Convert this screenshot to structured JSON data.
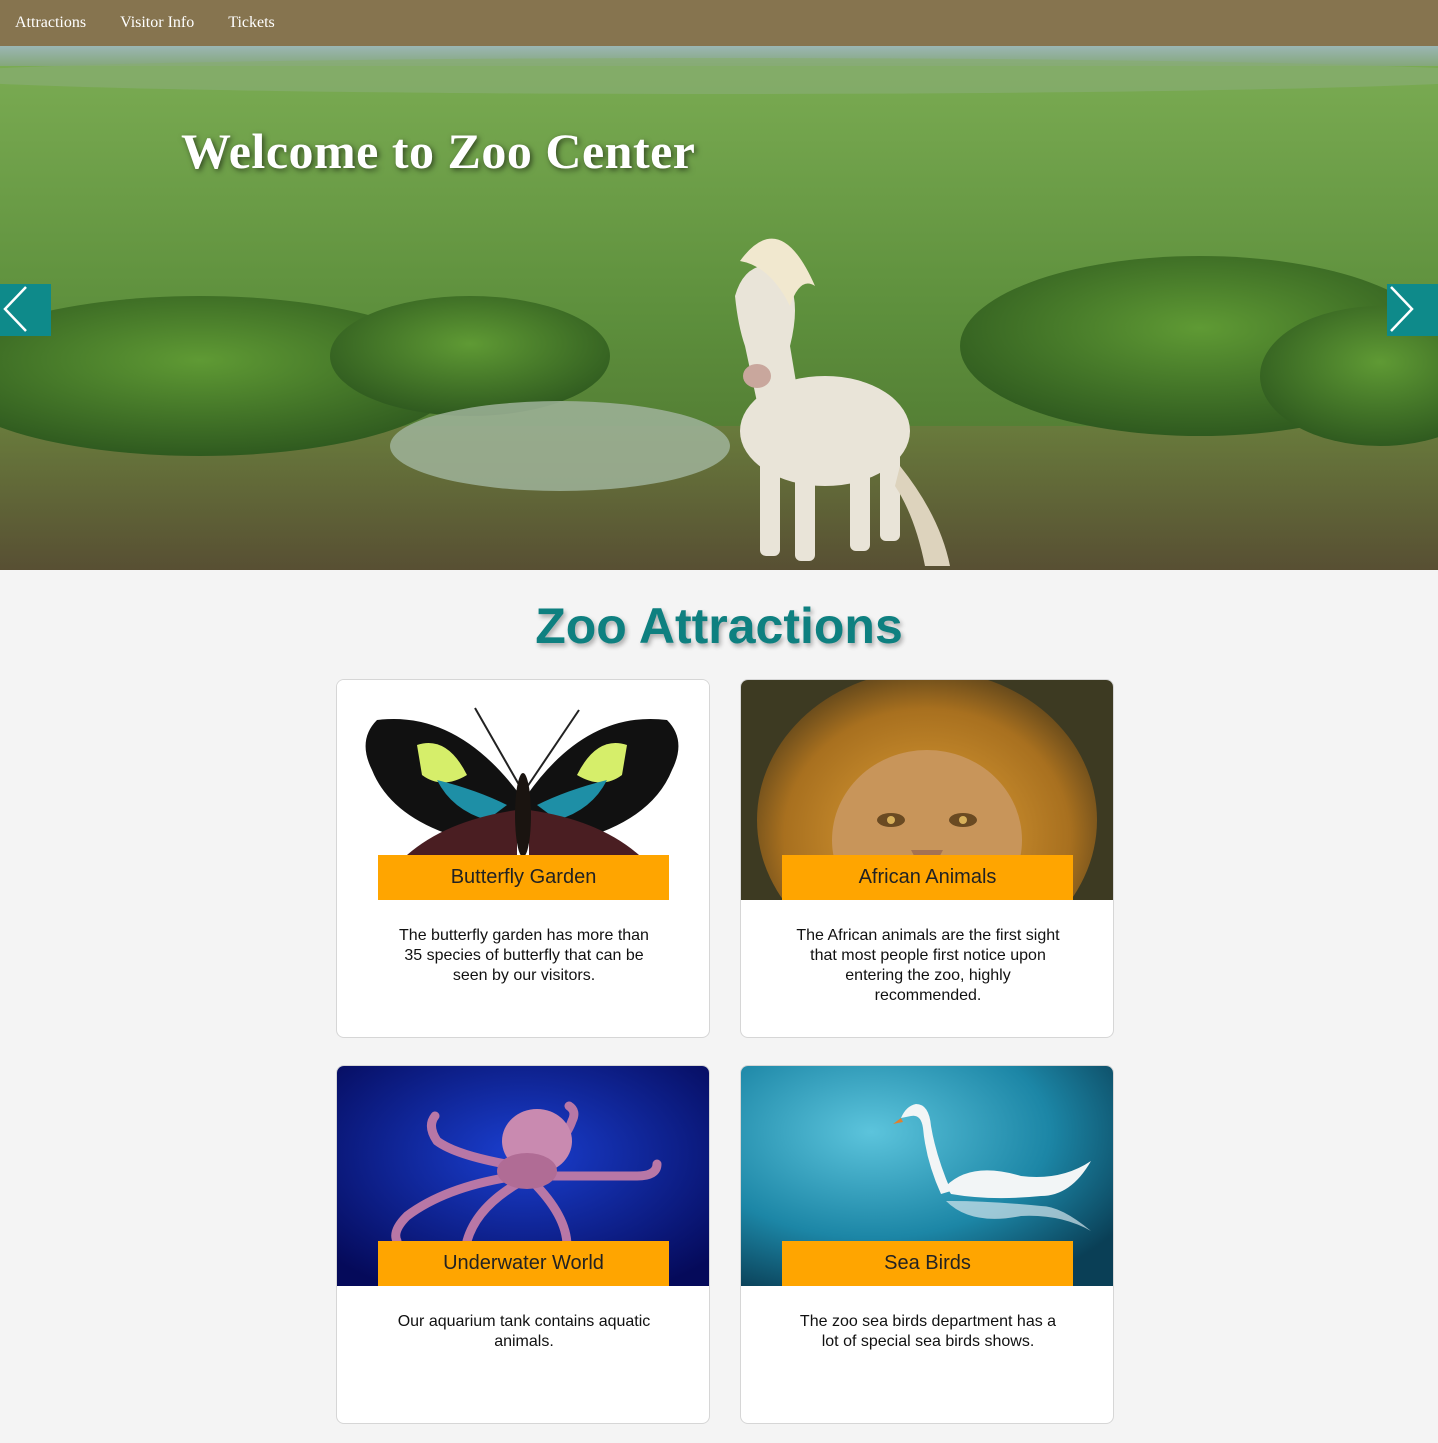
{
  "nav": {
    "items": [
      {
        "label": "Attractions"
      },
      {
        "label": "Visitor Info"
      },
      {
        "label": "Tickets"
      }
    ]
  },
  "hero": {
    "title": "Welcome to Zoo Center",
    "prev_icon": "chevron-left-icon",
    "next_icon": "chevron-right-icon"
  },
  "section": {
    "title": "Zoo Attractions"
  },
  "cards": [
    {
      "label": "Butterfly Garden",
      "description": "The butterfly garden has more than 35 species of butterfly that can be seen by our visitors.",
      "image": "butterfly"
    },
    {
      "label": "African Animals",
      "description": "The African animals are the first sight that most people first notice upon entering the zoo, highly recommended.",
      "image": "lion"
    },
    {
      "label": "Underwater World",
      "description": "Our aquarium tank contains aquatic animals.",
      "image": "octopus"
    },
    {
      "label": "Sea Birds",
      "description": "The zoo sea birds department has a lot of special sea birds shows.",
      "image": "swan"
    }
  ],
  "colors": {
    "nav_bg": "#86744f",
    "accent_teal": "#0e8a8a",
    "label_orange": "#ffa500",
    "page_bg": "#f4f4f4"
  }
}
